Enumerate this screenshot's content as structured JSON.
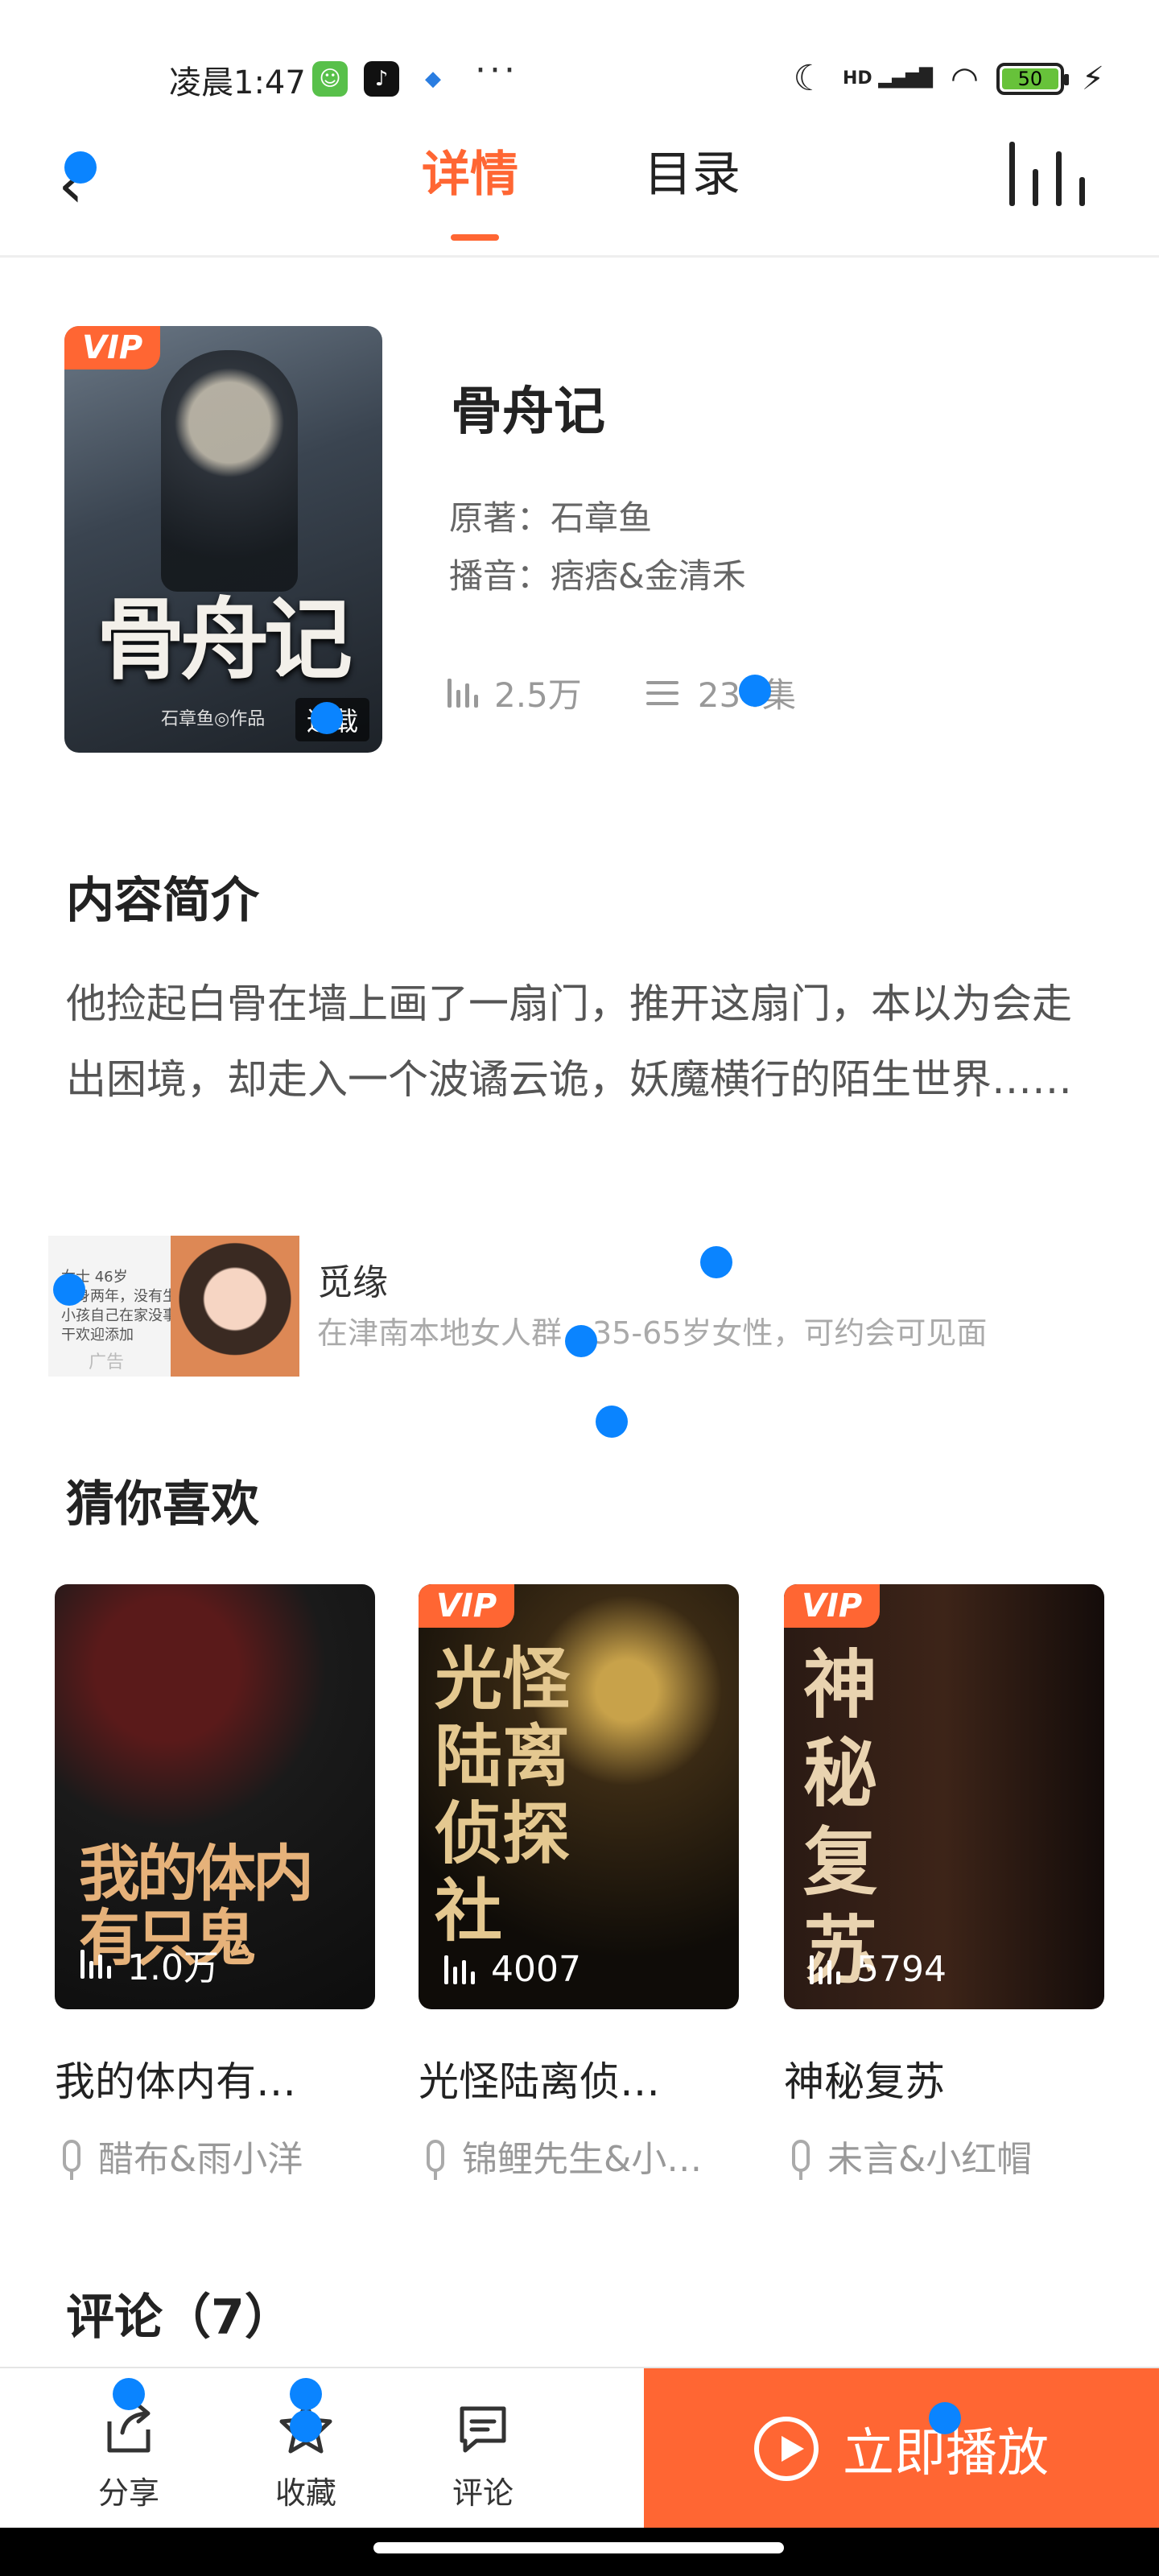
{
  "status_bar": {
    "time": "凌晨1:47",
    "battery": "50",
    "network": "HD",
    "more": "···"
  },
  "nav": {
    "tabs": [
      {
        "label": "详情",
        "active": true
      },
      {
        "label": "目录",
        "active": false
      }
    ]
  },
  "book": {
    "badge": "VIP",
    "cover_title_art": "骨舟记",
    "cover_author_art": "石章鱼◎作品",
    "cover_status": "连载",
    "title": "骨舟记",
    "author_line": "原著：石章鱼",
    "narrator_line": "播音：痞痞&金清禾",
    "plays": "2.5万",
    "episodes": "234集"
  },
  "intro": {
    "heading": "内容简介",
    "text": "他捡起白骨在墙上画了一扇门，推开这扇门，本以为会走出困境，却走入一个波谲云诡，妖魔横行的陌生世界……"
  },
  "ad": {
    "thumb_text": "女士 46岁\n单身两年，没有生小孩自己在家没事干欢迎添加",
    "tag": "广告",
    "name": "觅缘",
    "desc": "在津南本地女人群，35-65岁女性，可约会可见面"
  },
  "recommend": {
    "heading": "猜你喜欢",
    "items": [
      {
        "name": "我的体内有…",
        "anchor": "醋布&雨小洋",
        "plays": "1.0万",
        "vip": false,
        "art": "我的体内有只鬼"
      },
      {
        "name": "光怪陆离侦…",
        "anchor": "锦鲤先生&小…",
        "plays": "4007",
        "vip": true,
        "art": "光怪陆离侦探社"
      },
      {
        "name": "神秘复苏",
        "anchor": "未言&小红帽",
        "plays": "5794",
        "vip": true,
        "art": "神秘复苏"
      }
    ]
  },
  "comments": {
    "heading": "评论（7）"
  },
  "bottom_bar": {
    "share": "分享",
    "favorite": "收藏",
    "comment": "评论",
    "play": "立即播放"
  },
  "colors": {
    "accent": "#ff6633",
    "touch_indicator": "#0a84ff"
  }
}
